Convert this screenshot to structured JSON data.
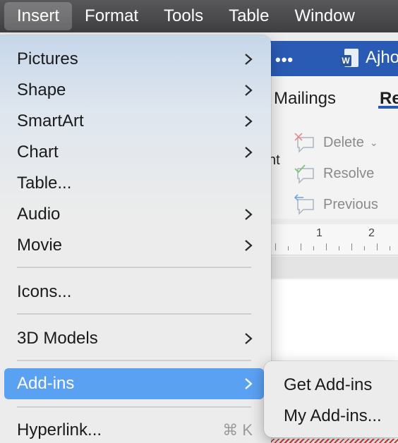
{
  "menubar": {
    "items": [
      "Insert",
      "Format",
      "Tools",
      "Table",
      "Window"
    ],
    "active": "Insert"
  },
  "word": {
    "title_dots": "•••",
    "doc_title": "Ajho",
    "tabs": {
      "mailings": "Mailings",
      "review": "Re"
    },
    "review_group": {
      "delete": "Delete",
      "resolve": "Resolve",
      "previous": "Previous",
      "comment_tail": "nt"
    },
    "ruler": [
      "1",
      "2"
    ]
  },
  "insert_menu": {
    "items": [
      {
        "label": "Pictures",
        "submenu": true
      },
      {
        "label": "Shape",
        "submenu": true
      },
      {
        "label": "SmartArt",
        "submenu": true
      },
      {
        "label": "Chart",
        "submenu": true
      },
      {
        "label": "Table...",
        "submenu": false
      },
      {
        "label": "Audio",
        "submenu": true
      },
      {
        "label": "Movie",
        "submenu": true
      },
      {
        "label": "Icons...",
        "submenu": false
      },
      {
        "label": "3D Models",
        "submenu": true
      },
      {
        "label": "Add-ins",
        "submenu": true,
        "highlighted": true
      },
      {
        "label": "Hyperlink...",
        "submenu": false,
        "shortcut": "⌘ K"
      }
    ]
  },
  "addins_submenu": {
    "items": [
      "Get Add-ins",
      "My Add-ins..."
    ]
  },
  "colors": {
    "highlight": "#5ba1f2",
    "word_blue": "#2a5bb4"
  }
}
